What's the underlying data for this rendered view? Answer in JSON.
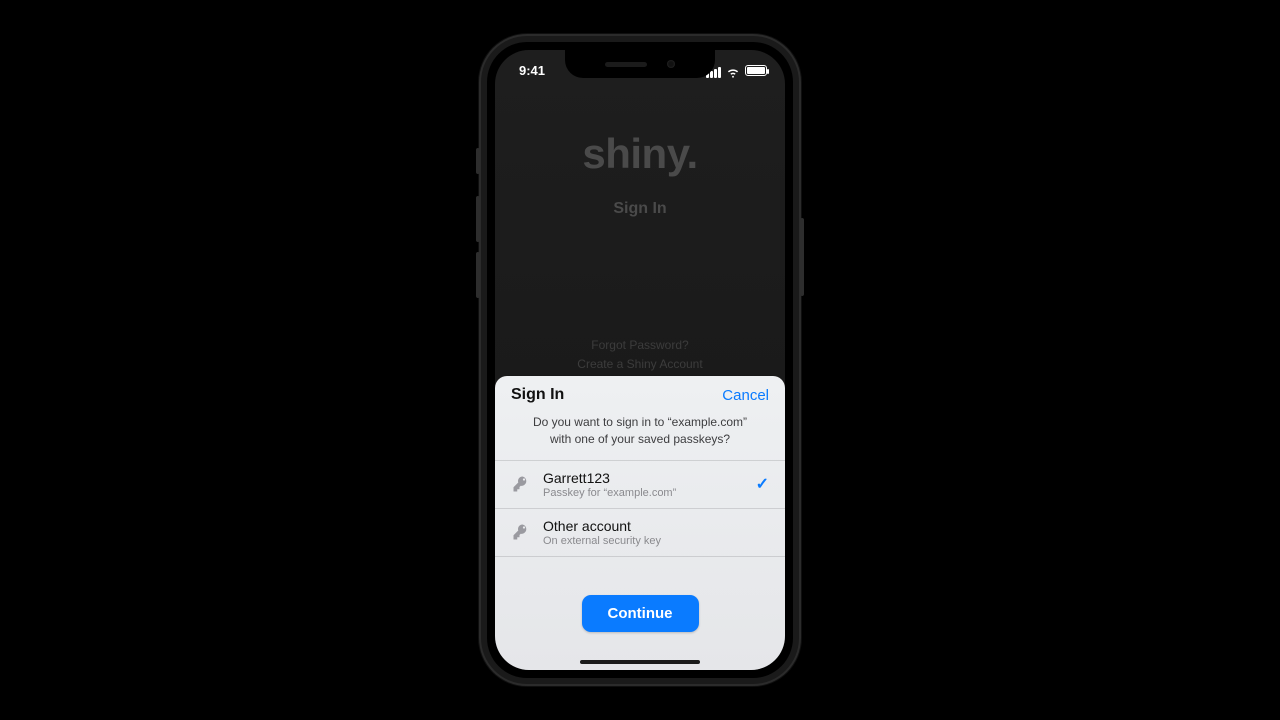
{
  "colors": {
    "accent": "#0a7bff",
    "sheet_bg": "#e9e9ec",
    "bg": "#000000"
  },
  "statusbar": {
    "time": "9:41"
  },
  "app_background": {
    "brand": "shiny.",
    "heading": "Sign In",
    "links": [
      "Forgot Password?",
      "Create a Shiny Account"
    ]
  },
  "sheet": {
    "title": "Sign In",
    "cancel_label": "Cancel",
    "message": "Do you want to sign in to “example.com” with one of your saved passkeys?",
    "accounts": [
      {
        "name": "Garrett123",
        "subtitle": "Passkey for “example.com”",
        "selected": true
      },
      {
        "name": "Other account",
        "subtitle": "On external security key",
        "selected": false
      }
    ],
    "continue_label": "Continue"
  }
}
